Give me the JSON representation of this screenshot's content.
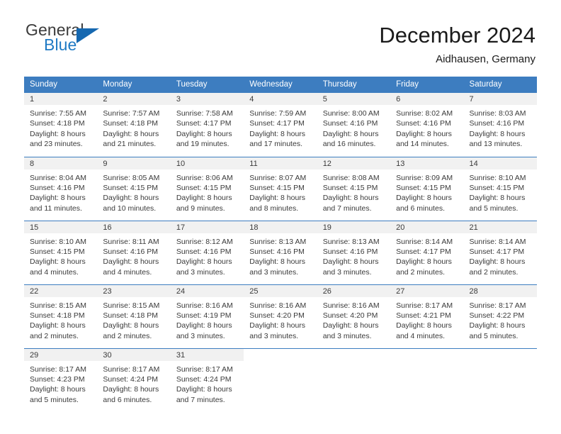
{
  "brand": {
    "name_part1": "General",
    "name_part2": "Blue",
    "triangle_color": "#1668b0",
    "blue_text_color": "#1f7ac4"
  },
  "header": {
    "title": "December 2024",
    "subtitle": "Aidhausen, Germany"
  },
  "theme": {
    "header_blue": "#3d7dc0",
    "row_divider": "#3d7dc0",
    "daynum_band": "#f1f1f1",
    "text": "#3a3a3a"
  },
  "weekday_headers": [
    "Sunday",
    "Monday",
    "Tuesday",
    "Wednesday",
    "Thursday",
    "Friday",
    "Saturday"
  ],
  "weeks": [
    [
      {
        "day": "1",
        "sunrise": "Sunrise: 7:55 AM",
        "sunset": "Sunset: 4:18 PM",
        "daylight1": "Daylight: 8 hours",
        "daylight2": "and 23 minutes."
      },
      {
        "day": "2",
        "sunrise": "Sunrise: 7:57 AM",
        "sunset": "Sunset: 4:18 PM",
        "daylight1": "Daylight: 8 hours",
        "daylight2": "and 21 minutes."
      },
      {
        "day": "3",
        "sunrise": "Sunrise: 7:58 AM",
        "sunset": "Sunset: 4:17 PM",
        "daylight1": "Daylight: 8 hours",
        "daylight2": "and 19 minutes."
      },
      {
        "day": "4",
        "sunrise": "Sunrise: 7:59 AM",
        "sunset": "Sunset: 4:17 PM",
        "daylight1": "Daylight: 8 hours",
        "daylight2": "and 17 minutes."
      },
      {
        "day": "5",
        "sunrise": "Sunrise: 8:00 AM",
        "sunset": "Sunset: 4:16 PM",
        "daylight1": "Daylight: 8 hours",
        "daylight2": "and 16 minutes."
      },
      {
        "day": "6",
        "sunrise": "Sunrise: 8:02 AM",
        "sunset": "Sunset: 4:16 PM",
        "daylight1": "Daylight: 8 hours",
        "daylight2": "and 14 minutes."
      },
      {
        "day": "7",
        "sunrise": "Sunrise: 8:03 AM",
        "sunset": "Sunset: 4:16 PM",
        "daylight1": "Daylight: 8 hours",
        "daylight2": "and 13 minutes."
      }
    ],
    [
      {
        "day": "8",
        "sunrise": "Sunrise: 8:04 AM",
        "sunset": "Sunset: 4:16 PM",
        "daylight1": "Daylight: 8 hours",
        "daylight2": "and 11 minutes."
      },
      {
        "day": "9",
        "sunrise": "Sunrise: 8:05 AM",
        "sunset": "Sunset: 4:15 PM",
        "daylight1": "Daylight: 8 hours",
        "daylight2": "and 10 minutes."
      },
      {
        "day": "10",
        "sunrise": "Sunrise: 8:06 AM",
        "sunset": "Sunset: 4:15 PM",
        "daylight1": "Daylight: 8 hours",
        "daylight2": "and 9 minutes."
      },
      {
        "day": "11",
        "sunrise": "Sunrise: 8:07 AM",
        "sunset": "Sunset: 4:15 PM",
        "daylight1": "Daylight: 8 hours",
        "daylight2": "and 8 minutes."
      },
      {
        "day": "12",
        "sunrise": "Sunrise: 8:08 AM",
        "sunset": "Sunset: 4:15 PM",
        "daylight1": "Daylight: 8 hours",
        "daylight2": "and 7 minutes."
      },
      {
        "day": "13",
        "sunrise": "Sunrise: 8:09 AM",
        "sunset": "Sunset: 4:15 PM",
        "daylight1": "Daylight: 8 hours",
        "daylight2": "and 6 minutes."
      },
      {
        "day": "14",
        "sunrise": "Sunrise: 8:10 AM",
        "sunset": "Sunset: 4:15 PM",
        "daylight1": "Daylight: 8 hours",
        "daylight2": "and 5 minutes."
      }
    ],
    [
      {
        "day": "15",
        "sunrise": "Sunrise: 8:10 AM",
        "sunset": "Sunset: 4:15 PM",
        "daylight1": "Daylight: 8 hours",
        "daylight2": "and 4 minutes."
      },
      {
        "day": "16",
        "sunrise": "Sunrise: 8:11 AM",
        "sunset": "Sunset: 4:16 PM",
        "daylight1": "Daylight: 8 hours",
        "daylight2": "and 4 minutes."
      },
      {
        "day": "17",
        "sunrise": "Sunrise: 8:12 AM",
        "sunset": "Sunset: 4:16 PM",
        "daylight1": "Daylight: 8 hours",
        "daylight2": "and 3 minutes."
      },
      {
        "day": "18",
        "sunrise": "Sunrise: 8:13 AM",
        "sunset": "Sunset: 4:16 PM",
        "daylight1": "Daylight: 8 hours",
        "daylight2": "and 3 minutes."
      },
      {
        "day": "19",
        "sunrise": "Sunrise: 8:13 AM",
        "sunset": "Sunset: 4:16 PM",
        "daylight1": "Daylight: 8 hours",
        "daylight2": "and 3 minutes."
      },
      {
        "day": "20",
        "sunrise": "Sunrise: 8:14 AM",
        "sunset": "Sunset: 4:17 PM",
        "daylight1": "Daylight: 8 hours",
        "daylight2": "and 2 minutes."
      },
      {
        "day": "21",
        "sunrise": "Sunrise: 8:14 AM",
        "sunset": "Sunset: 4:17 PM",
        "daylight1": "Daylight: 8 hours",
        "daylight2": "and 2 minutes."
      }
    ],
    [
      {
        "day": "22",
        "sunrise": "Sunrise: 8:15 AM",
        "sunset": "Sunset: 4:18 PM",
        "daylight1": "Daylight: 8 hours",
        "daylight2": "and 2 minutes."
      },
      {
        "day": "23",
        "sunrise": "Sunrise: 8:15 AM",
        "sunset": "Sunset: 4:18 PM",
        "daylight1": "Daylight: 8 hours",
        "daylight2": "and 2 minutes."
      },
      {
        "day": "24",
        "sunrise": "Sunrise: 8:16 AM",
        "sunset": "Sunset: 4:19 PM",
        "daylight1": "Daylight: 8 hours",
        "daylight2": "and 3 minutes."
      },
      {
        "day": "25",
        "sunrise": "Sunrise: 8:16 AM",
        "sunset": "Sunset: 4:20 PM",
        "daylight1": "Daylight: 8 hours",
        "daylight2": "and 3 minutes."
      },
      {
        "day": "26",
        "sunrise": "Sunrise: 8:16 AM",
        "sunset": "Sunset: 4:20 PM",
        "daylight1": "Daylight: 8 hours",
        "daylight2": "and 3 minutes."
      },
      {
        "day": "27",
        "sunrise": "Sunrise: 8:17 AM",
        "sunset": "Sunset: 4:21 PM",
        "daylight1": "Daylight: 8 hours",
        "daylight2": "and 4 minutes."
      },
      {
        "day": "28",
        "sunrise": "Sunrise: 8:17 AM",
        "sunset": "Sunset: 4:22 PM",
        "daylight1": "Daylight: 8 hours",
        "daylight2": "and 5 minutes."
      }
    ],
    [
      {
        "day": "29",
        "sunrise": "Sunrise: 8:17 AM",
        "sunset": "Sunset: 4:23 PM",
        "daylight1": "Daylight: 8 hours",
        "daylight2": "and 5 minutes."
      },
      {
        "day": "30",
        "sunrise": "Sunrise: 8:17 AM",
        "sunset": "Sunset: 4:24 PM",
        "daylight1": "Daylight: 8 hours",
        "daylight2": "and 6 minutes."
      },
      {
        "day": "31",
        "sunrise": "Sunrise: 8:17 AM",
        "sunset": "Sunset: 4:24 PM",
        "daylight1": "Daylight: 8 hours",
        "daylight2": "and 7 minutes."
      },
      {
        "day": "",
        "sunrise": "",
        "sunset": "",
        "daylight1": "",
        "daylight2": ""
      },
      {
        "day": "",
        "sunrise": "",
        "sunset": "",
        "daylight1": "",
        "daylight2": ""
      },
      {
        "day": "",
        "sunrise": "",
        "sunset": "",
        "daylight1": "",
        "daylight2": ""
      },
      {
        "day": "",
        "sunrise": "",
        "sunset": "",
        "daylight1": "",
        "daylight2": ""
      }
    ]
  ]
}
